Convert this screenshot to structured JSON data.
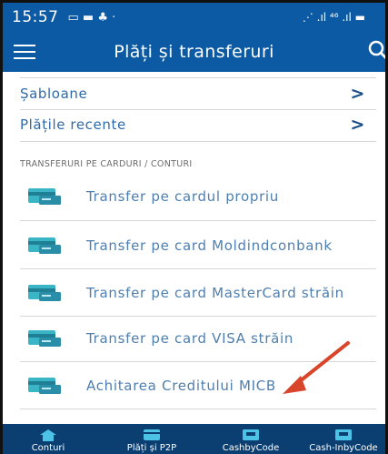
{
  "status_bar": {
    "time": "15:57",
    "left_icons": "▭ ▬ ♣ ·",
    "right_icons": "⋰ .ıl ⁴⁶ .ıl ▬"
  },
  "app_bar": {
    "title": "Plăți și transferuri",
    "menu_icon": "menu-icon",
    "search_icon": "search-icon"
  },
  "nav_rows": [
    {
      "label": "Șabloane"
    },
    {
      "label": "Plățile recente"
    }
  ],
  "chevron": ">",
  "section_header": "TRANSFERURI PE CARDURI / CONTURI",
  "transfers": [
    {
      "label": "Transfer pe cardul propriu"
    },
    {
      "label": "Transfer pe card Moldindconbank"
    },
    {
      "label": "Transfer pe card MasterCard străin"
    },
    {
      "label": "Transfer pe card VISA străin"
    },
    {
      "label": "Achitarea Creditului MICB"
    }
  ],
  "bottom_nav": [
    {
      "label": "Conturi",
      "icon": "home-icon"
    },
    {
      "label": "Plăți și P2P",
      "icon": "card-icon"
    },
    {
      "label": "CashbyCode",
      "icon": "atm-icon"
    },
    {
      "label": "Cash-InbyCode",
      "icon": "atm-in-icon"
    }
  ],
  "colors": {
    "primary": "#0b5aa3",
    "bottom_nav": "#0b3f72",
    "link_text": "#2f6aa8",
    "icon_teal": "#3ab5c6",
    "arrow": "#d9452b"
  }
}
